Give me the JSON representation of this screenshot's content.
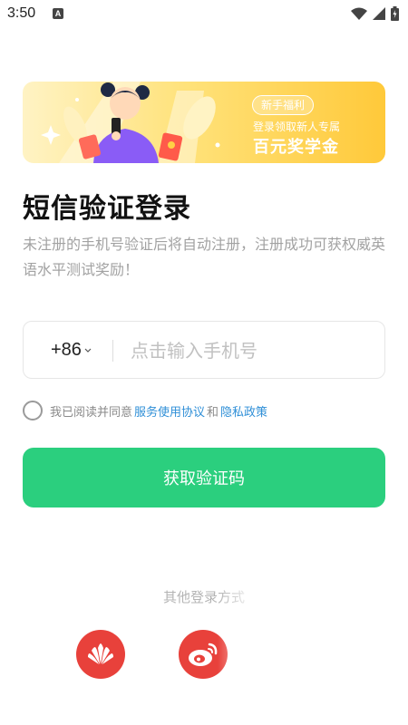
{
  "status_bar": {
    "time": "3:50",
    "notification_letter": "A",
    "icons": [
      "wifi-icon",
      "signal-icon",
      "battery-icon"
    ]
  },
  "banner": {
    "tag": "新手福利",
    "subtitle": "登录领取新人专属",
    "headline": "百元奖学金"
  },
  "title": "短信验证登录",
  "subtitle": "未注册的手机号验证后将自动注册，注册成功可获权威英语水平测试奖励！",
  "phone": {
    "country_code": "+86",
    "placeholder": "点击输入手机号",
    "value": ""
  },
  "agreement": {
    "prefix": "我已阅读并同意",
    "terms_link": "服务使用协议",
    "conjunction": "和",
    "privacy_link": "隐私政策",
    "checked": false
  },
  "get_code_button": "获取验证码",
  "other_login": {
    "label": "其他登录方式",
    "options": [
      "huawei-icon",
      "weibo-icon"
    ]
  },
  "colors": {
    "primary": "#2bcf7e",
    "link": "#2f8fd7",
    "social": "#e8413b",
    "banner_gold": "#ffc93a"
  }
}
